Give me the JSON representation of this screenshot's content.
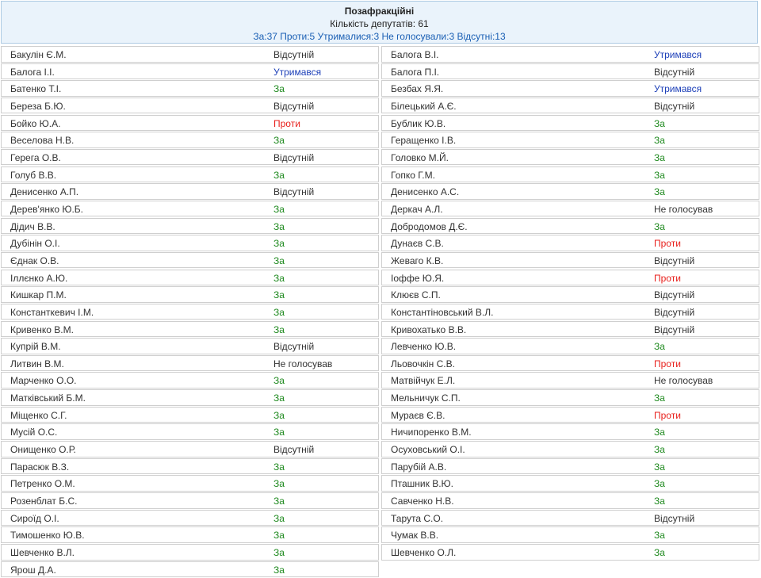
{
  "header": {
    "title": "Позафракційні",
    "count_text": "Кількість депутатів: 61",
    "summary_text": "За:37 Проти:5 Утрималися:3 Не голосували:3 Відсутні:13"
  },
  "colors": {
    "for": "#1f8a1f",
    "against": "#e8211d",
    "abstain": "#1c3fb8",
    "absent": "#333333",
    "header_bg": "#eaf3fb",
    "header_border": "#aecbe3"
  },
  "left_column": [
    {
      "name": "Бакулін Є.М.",
      "vote": "Відсутній",
      "type": "absent"
    },
    {
      "name": "Балога І.І.",
      "vote": "Утримався",
      "type": "abstain"
    },
    {
      "name": "Батенко Т.І.",
      "vote": "За",
      "type": "for"
    },
    {
      "name": "Береза Б.Ю.",
      "vote": "Відсутній",
      "type": "absent"
    },
    {
      "name": "Бойко Ю.А.",
      "vote": "Проти",
      "type": "against"
    },
    {
      "name": "Веселова Н.В.",
      "vote": "За",
      "type": "for"
    },
    {
      "name": "Герега О.В.",
      "vote": "Відсутній",
      "type": "absent"
    },
    {
      "name": "Голуб В.В.",
      "vote": "За",
      "type": "for"
    },
    {
      "name": "Денисенко А.П.",
      "vote": "Відсутній",
      "type": "absent"
    },
    {
      "name": "Дерев'янко Ю.Б.",
      "vote": "За",
      "type": "for"
    },
    {
      "name": "Дідич В.В.",
      "vote": "За",
      "type": "for"
    },
    {
      "name": "Дубінін О.І.",
      "vote": "За",
      "type": "for"
    },
    {
      "name": "Єднак О.В.",
      "vote": "За",
      "type": "for"
    },
    {
      "name": "Іллєнко А.Ю.",
      "vote": "За",
      "type": "for"
    },
    {
      "name": "Кишкар П.М.",
      "vote": "За",
      "type": "for"
    },
    {
      "name": "Константкевич І.М.",
      "vote": "За",
      "type": "for"
    },
    {
      "name": "Кривенко В.М.",
      "vote": "За",
      "type": "for"
    },
    {
      "name": "Купрій В.М.",
      "vote": "Відсутній",
      "type": "absent"
    },
    {
      "name": "Литвин В.М.",
      "vote": "Не голосував",
      "type": "novote"
    },
    {
      "name": "Марченко О.О.",
      "vote": "За",
      "type": "for"
    },
    {
      "name": "Матківський Б.М.",
      "vote": "За",
      "type": "for"
    },
    {
      "name": "Міщенко С.Г.",
      "vote": "За",
      "type": "for"
    },
    {
      "name": "Мусій О.С.",
      "vote": "За",
      "type": "for"
    },
    {
      "name": "Онищенко О.Р.",
      "vote": "Відсутній",
      "type": "absent"
    },
    {
      "name": "Парасюк В.З.",
      "vote": "За",
      "type": "for"
    },
    {
      "name": "Петренко О.М.",
      "vote": "За",
      "type": "for"
    },
    {
      "name": "Розенблат Б.С.",
      "vote": "За",
      "type": "for"
    },
    {
      "name": "Сироїд О.І.",
      "vote": "За",
      "type": "for"
    },
    {
      "name": "Тимошенко Ю.В.",
      "vote": "За",
      "type": "for"
    },
    {
      "name": "Шевченко В.Л.",
      "vote": "За",
      "type": "for"
    },
    {
      "name": "Ярош Д.А.",
      "vote": "За",
      "type": "for"
    }
  ],
  "right_column": [
    {
      "name": "Балога В.І.",
      "vote": "Утримався",
      "type": "abstain"
    },
    {
      "name": "Балога П.І.",
      "vote": "Відсутній",
      "type": "absent"
    },
    {
      "name": "Безбах Я.Я.",
      "vote": "Утримався",
      "type": "abstain"
    },
    {
      "name": "Білецький А.Є.",
      "vote": "Відсутній",
      "type": "absent"
    },
    {
      "name": "Бублик Ю.В.",
      "vote": "За",
      "type": "for"
    },
    {
      "name": "Геращенко І.В.",
      "vote": "За",
      "type": "for"
    },
    {
      "name": "Головко М.Й.",
      "vote": "За",
      "type": "for"
    },
    {
      "name": "Гопко Г.М.",
      "vote": "За",
      "type": "for"
    },
    {
      "name": "Денисенко А.С.",
      "vote": "За",
      "type": "for"
    },
    {
      "name": "Деркач А.Л.",
      "vote": "Не голосував",
      "type": "novote"
    },
    {
      "name": "Добродомов Д.Є.",
      "vote": "За",
      "type": "for"
    },
    {
      "name": "Дунаєв С.В.",
      "vote": "Проти",
      "type": "against"
    },
    {
      "name": "Жеваго К.В.",
      "vote": "Відсутній",
      "type": "absent"
    },
    {
      "name": "Іоффе Ю.Я.",
      "vote": "Проти",
      "type": "against"
    },
    {
      "name": "Клюєв С.П.",
      "vote": "Відсутній",
      "type": "absent"
    },
    {
      "name": "Константіновський В.Л.",
      "vote": "Відсутній",
      "type": "absent"
    },
    {
      "name": "Кривохатько В.В.",
      "vote": "Відсутній",
      "type": "absent"
    },
    {
      "name": "Левченко Ю.В.",
      "vote": "За",
      "type": "for"
    },
    {
      "name": "Льовочкін С.В.",
      "vote": "Проти",
      "type": "against"
    },
    {
      "name": "Матвійчук Е.Л.",
      "vote": "Не голосував",
      "type": "novote"
    },
    {
      "name": "Мельничук С.П.",
      "vote": "За",
      "type": "for"
    },
    {
      "name": "Мураєв Є.В.",
      "vote": "Проти",
      "type": "against"
    },
    {
      "name": "Ничипоренко В.М.",
      "vote": "За",
      "type": "for"
    },
    {
      "name": "Осуховський О.І.",
      "vote": "За",
      "type": "for"
    },
    {
      "name": "Парубій А.В.",
      "vote": "За",
      "type": "for"
    },
    {
      "name": "Пташник В.Ю.",
      "vote": "За",
      "type": "for"
    },
    {
      "name": "Савченко Н.В.",
      "vote": "За",
      "type": "for"
    },
    {
      "name": "Тарута С.О.",
      "vote": "Відсутній",
      "type": "absent"
    },
    {
      "name": "Чумак В.В.",
      "vote": "За",
      "type": "for"
    },
    {
      "name": "Шевченко О.Л.",
      "vote": "За",
      "type": "for"
    }
  ]
}
